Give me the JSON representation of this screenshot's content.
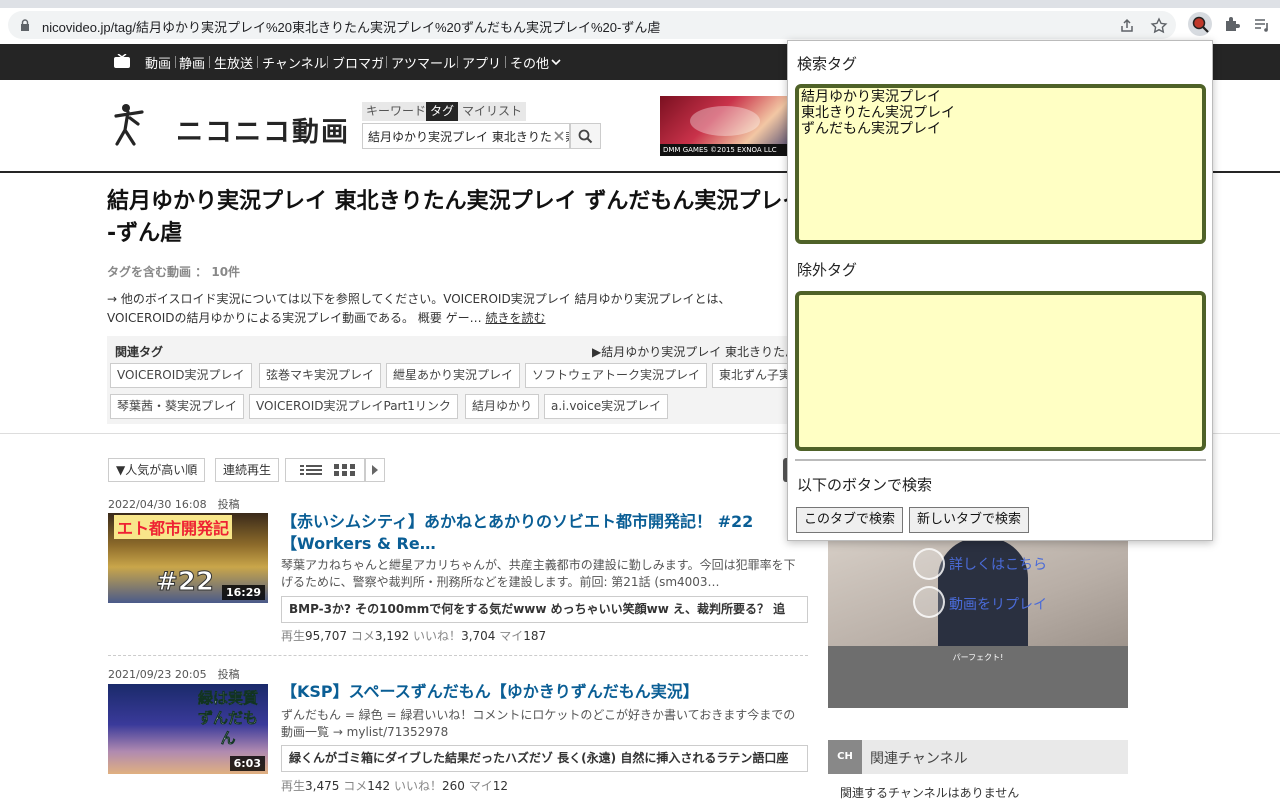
{
  "browser": {
    "url": "nicovideo.jp/tag/結月ゆかり実況プレイ%20東北きりたん実況プレイ%20ずんだもん実況プレイ%20-ずん虐"
  },
  "nav": {
    "items": [
      "動画",
      "静画",
      "生放送",
      "チャンネル",
      "ブロマガ",
      "アツマール",
      "アプリ",
      "その他"
    ]
  },
  "header": {
    "logo_text": "ニコニコ動画",
    "search_tabs": [
      "キーワード",
      "タグ",
      "マイリスト"
    ],
    "active_tab": "タグ",
    "search_value": "結月ゆかり実況プレイ 東北きりたん実況プレイ ずんだもん実況プレイ -ずん虐",
    "ad_label": "DMM GAMES  ©2015 EXNOA LLC"
  },
  "page": {
    "title": "結月ゆかり実況プレイ 東北きりたん実況プレイ ずんだもん実況プレイ -ずん虐",
    "tag_count": "タグを含む動画 ： 10件",
    "description": "→ 他のボイスロイド実況については以下を参照してください。VOICEROID実況プレイ 結月ゆかり実況プレイとは、VOICEROIDの結月ゆかりによる実況プレイ動画である。 概要 ゲー…",
    "read_more": "続きを読む"
  },
  "related": {
    "title": "関連タグ",
    "right_link": "▶結月ゆかり実況プレイ 東北きりたん",
    "tags": [
      "VOICEROID実況プレイ",
      "弦巻マキ実況プレイ",
      "紲星あかり実況プレイ",
      "ソフトウェアトーク実況プレイ",
      "東北ずん子実況",
      "琴葉茜・葵実況プレイ",
      "VOICEROID実況プレイPart1リンク",
      "結月ゆかり",
      "a.i.voice実況プレイ"
    ]
  },
  "controls": {
    "sort": "▼人気が高い順",
    "continuous": "連続再生"
  },
  "videos": [
    {
      "date": "2022/04/30 16:08　投稿",
      "title": "【赤いシムシティ】あかねとあかりのソビエト都市開発記！ #22【Workers & Re…",
      "desc": "琴葉アカねちゃんと紲星アカリちゃんが、共産主義都市の建設に勤しみます。今回は犯罪率を下げるために、警察や裁判所・刑務所などを建設します。前回: 第21話 (sm4003…",
      "comment": "BMP-3か? その100mmで何をする気だwww めっちゃいい笑顔ww え、裁判所要る？ 追",
      "duration": "16:29",
      "thumb_text": "エト都市開発記",
      "thumb_num": "#22",
      "views": "95,707",
      "comments": "3,192",
      "likes": "3,704",
      "mylists": "187"
    },
    {
      "date": "2021/09/23 20:05　投稿",
      "title": "【KSP】スペースずんだもん【ゆかきりずんだもん実況】",
      "desc": "ずんだもん = 緑色 = 緑君いいね！コメントにロケットのどこが好きか書いておきます今までの動画一覧 → mylist/71352978",
      "comment": "緑くんがゴミ箱にダイブした結果だったハズだゾ 長く(永遠) 自然に挿入されるラテン語口座",
      "duration": "6:03",
      "thumb_text": "緑は実質ずんだもん",
      "views": "3,475",
      "comments": "142",
      "likes": "260",
      "mylists": "12"
    }
  ],
  "stat_labels": {
    "views": "再生",
    "comments": "コメ",
    "likes": "いいね！",
    "mylists": "マイ"
  },
  "side": {
    "link_details": "詳しくはこちら",
    "link_replay": "動画をリプレイ",
    "perfect": "パーフェクト!",
    "channel_title": "関連チャンネル",
    "channel_empty": "関連するチャンネルはありません",
    "ch_icon": "CH"
  },
  "popup": {
    "search_label": "検索タグ",
    "search_tags": "結月ゆかり実況プレイ\n東北きりたん実況プレイ\nずんだもん実況プレイ",
    "exclude_label": "除外タグ",
    "exclude_tags": "",
    "button_hint": "以下のボタンで検索",
    "btn_this_tab": "このタブで検索",
    "btn_new_tab": "新しいタブで検索"
  },
  "colors": {
    "textarea_bg": "#ffffc4",
    "textarea_border": "#4f6228",
    "video_title": "#0a5e95",
    "nav_bg": "#252525"
  }
}
